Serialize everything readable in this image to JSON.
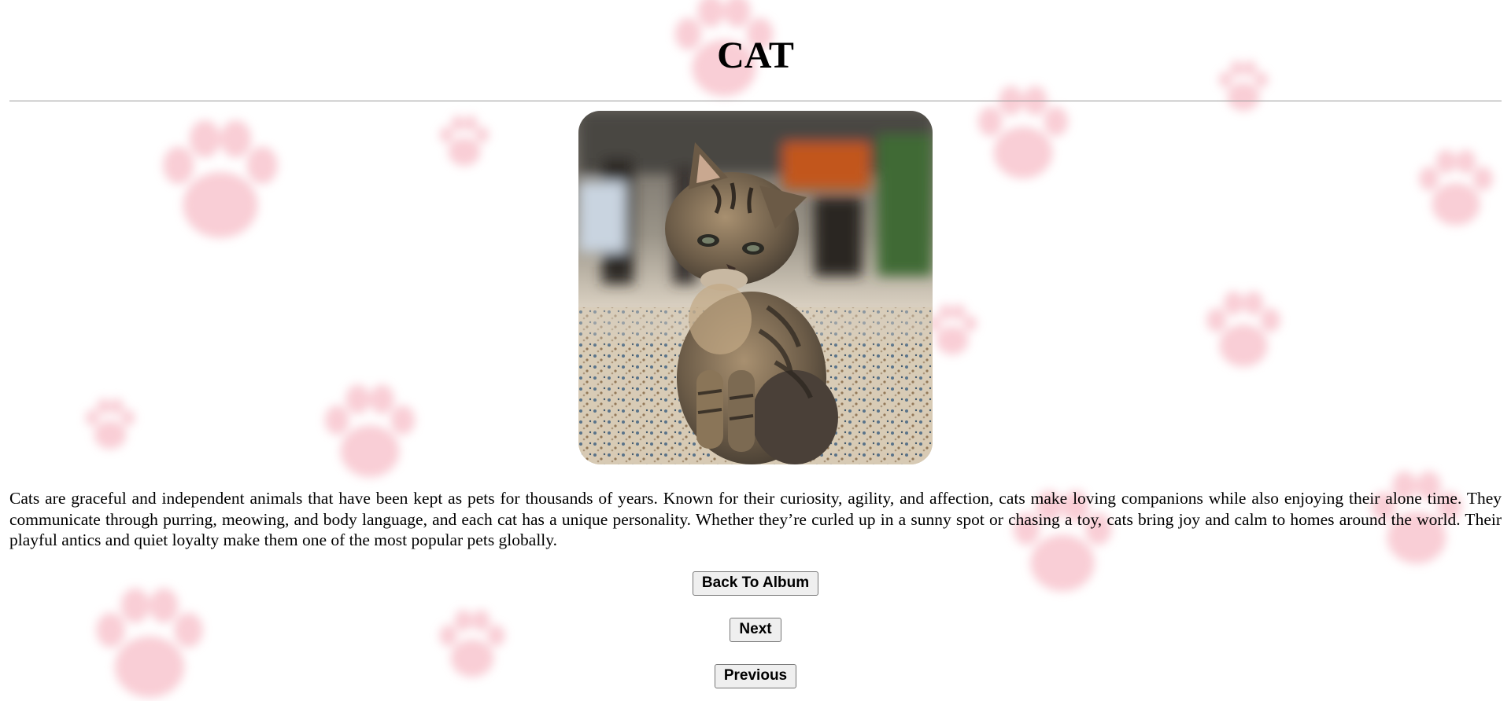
{
  "page": {
    "title": "CAT",
    "description": "Cats are graceful and independent animals that have been kept as pets for thousands of years. Known for their curiosity, agility, and affection, cats make loving companions while also enjoying their alone time. They communicate through purring, meowing, and body language, and each cat has a unique personality. Whether they’re curled up in a sunny spot or chasing a toy, cats bring joy and calm to homes around the world. Their playful antics and quiet loyalty make them one of the most popular pets globally."
  },
  "buttons": {
    "back_label": "Back To Album",
    "next_label": "Next",
    "previous_label": "Previous"
  },
  "theme": {
    "background": "#ffffff",
    "paw_color": "#f4a6b4",
    "divider_color": "#999999",
    "button_bg": "#efefef",
    "button_border": "#767676"
  },
  "icons": {
    "background_pattern": "paw-print-pattern"
  }
}
